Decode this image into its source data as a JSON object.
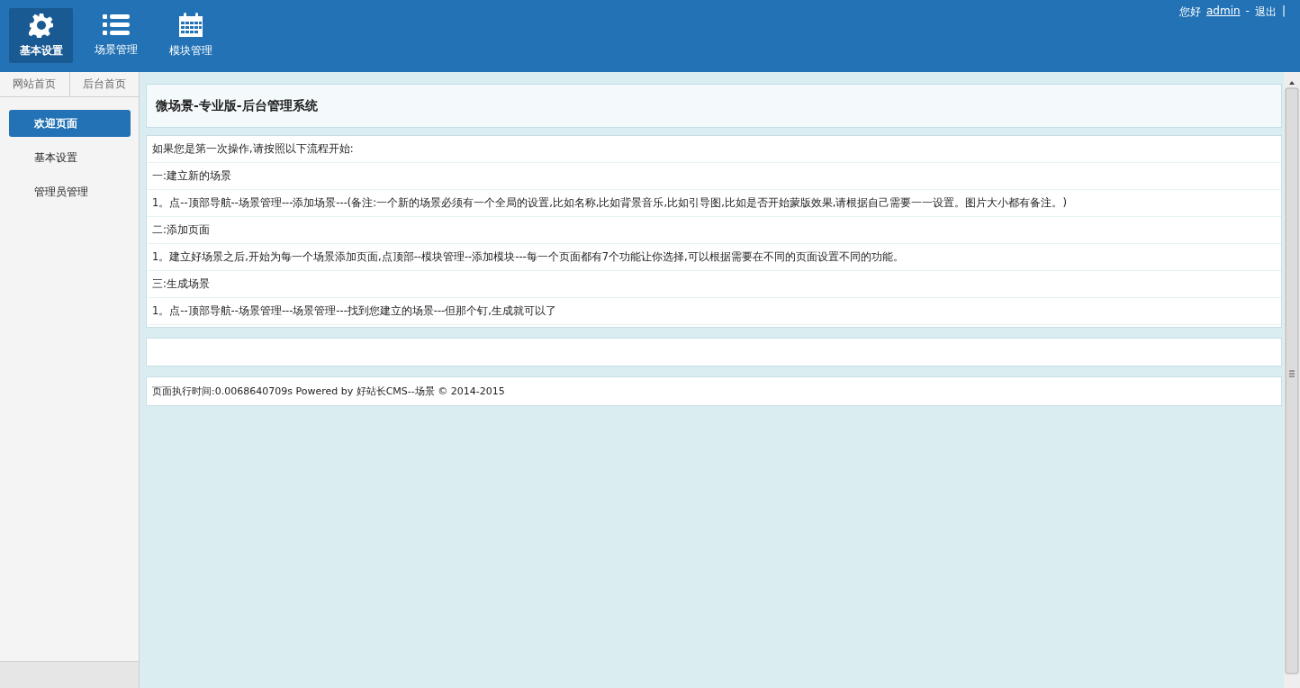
{
  "top_nav": [
    {
      "label": "基本设置",
      "selected": true
    },
    {
      "label": "场景管理",
      "selected": false
    },
    {
      "label": "模块管理",
      "selected": false
    }
  ],
  "user_bar": {
    "greeting": "您好",
    "username": "admin",
    "separator": "-",
    "logout": "退出",
    "trailer": "|"
  },
  "sidebar": {
    "tabs": [
      {
        "label": "网站首页"
      },
      {
        "label": "后台首页"
      }
    ],
    "items": [
      {
        "label": "欢迎页面",
        "selected": true
      },
      {
        "label": "基本设置",
        "selected": false
      },
      {
        "label": "管理员管理",
        "selected": false
      }
    ]
  },
  "main": {
    "title": "微场景-专业版-后台管理系统",
    "lines": [
      "如果您是第一次操作,请按照以下流程开始:",
      "一:建立新的场景",
      "1。点--顶部导航--场景管理---添加场景---(备注:一个新的场景必须有一个全局的设置,比如名称,比如背景音乐,比如引导图,比如是否开始蒙版效果,请根据自己需要一一设置。图片大小都有备注。)",
      "二:添加页面",
      "1。建立好场景之后,开始为每一个场景添加页面,点顶部--模块管理--添加模块---每一个页面都有7个功能让你选择,可以根据需要在不同的页面设置不同的功能。",
      "三:生成场景",
      "1。点--顶部导航--场景管理---场景管理---找到您建立的场景---但那个钉,生成就可以了"
    ],
    "footer": "页面执行时间:0.0068640709s Powered by 好站长CMS--场景 © 2014-2015"
  }
}
